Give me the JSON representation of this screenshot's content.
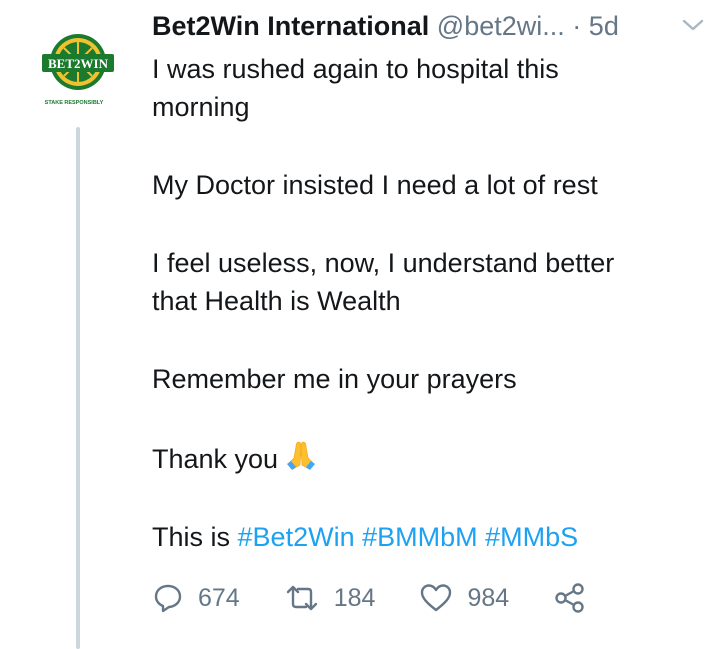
{
  "tweet": {
    "author_name": "Bet2Win International",
    "handle": "@bet2wi...",
    "separator": "·",
    "timestamp": "5d",
    "paragraphs": [
      {
        "lines": [
          "I was rushed again to hospital this",
          "morning"
        ]
      },
      {
        "lines": [
          "My Doctor insisted I need a lot of rest"
        ]
      },
      {
        "lines": [
          "I feel useless, now, I understand better",
          "that Health is Wealth"
        ]
      },
      {
        "lines": [
          "Remember me in your prayers"
        ]
      }
    ],
    "thanks_text": "Thank you",
    "thanks_emoji": "folded-hands-emoji",
    "tag_prefix": "This is",
    "hashtags": [
      "#Bet2Win",
      "#BMMbM",
      "#MMbS"
    ]
  },
  "avatar": {
    "logo_text": "BET2WIN",
    "tagline": "STAKE RESPONSIBLY"
  },
  "actions": {
    "reply_count": "674",
    "retweet_count": "184",
    "like_count": "984"
  },
  "colors": {
    "text": "#14171a",
    "secondary": "#657786",
    "link": "#1da1f2",
    "logo_green": "#1b7a2e",
    "logo_yellow": "#f2c12e",
    "thread_line": "#ccd6dd"
  }
}
